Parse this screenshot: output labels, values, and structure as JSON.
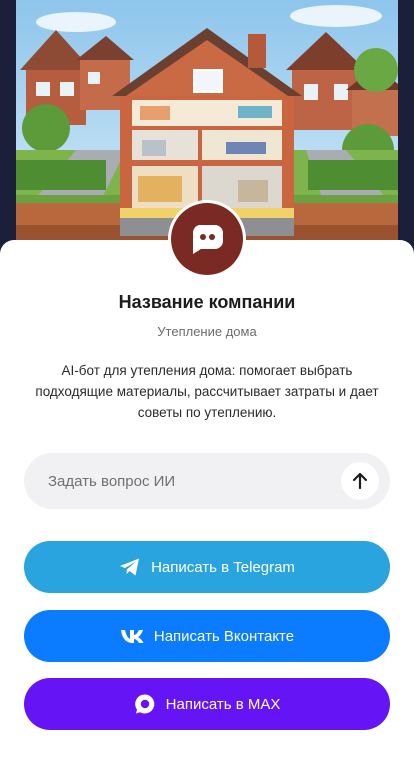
{
  "hero": {
    "image": "house-insulation-cutaway-illustration"
  },
  "profile": {
    "avatar_icon": "chat-bubble-icon",
    "avatar_color": "#7a2a22",
    "company_name": "Название компании",
    "subtitle": "Утепление дома",
    "description": "AI-бот для утепления дома: помогает выбрать подходящие материалы, рассчитывает затраты и дает советы по утеплению."
  },
  "ask": {
    "placeholder": "Задать вопрос ИИ",
    "value": "",
    "send_icon": "arrow-up-icon"
  },
  "buttons": {
    "telegram": {
      "label": "Написать в Telegram",
      "color": "#2aa4de",
      "icon": "telegram-icon"
    },
    "vk": {
      "label": "Написать Вконтакте",
      "color": "#0b7cff",
      "icon": "vk-icon"
    },
    "max": {
      "label": "Написать в MAX",
      "color": "#6515f5",
      "icon": "max-icon"
    }
  }
}
